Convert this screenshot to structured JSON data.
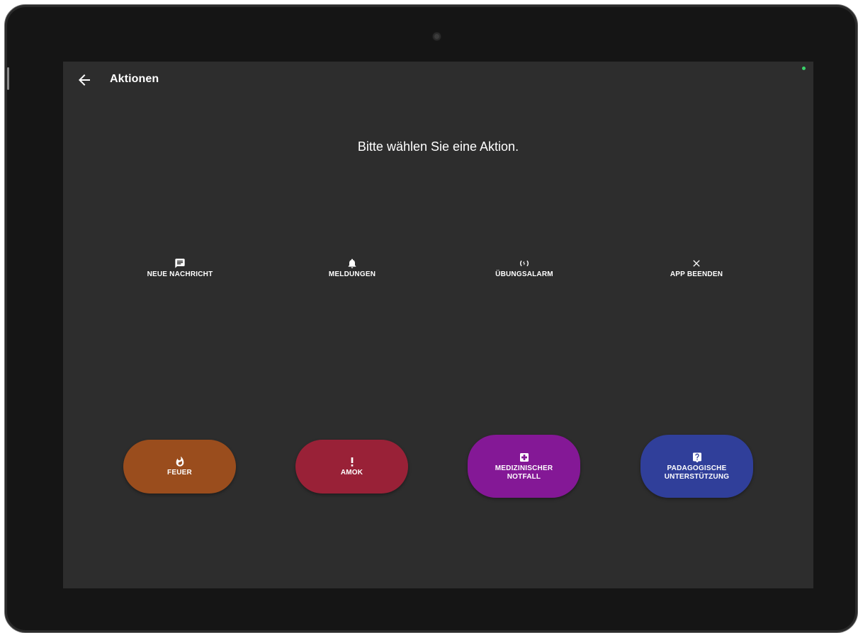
{
  "appbar": {
    "title": "Aktionen",
    "back_icon": "arrow-back-icon"
  },
  "main": {
    "prompt": "Bitte wählen Sie eine Aktion."
  },
  "actions": [
    {
      "label": "NEUE NACHRICHT",
      "icon": "message-icon"
    },
    {
      "label": "MELDUNGEN",
      "icon": "bell-icon"
    },
    {
      "label": "ÜBUNGSALARM",
      "icon": "alarm-practice-icon"
    },
    {
      "label": "APP BEENDEN",
      "icon": "close-icon"
    }
  ],
  "alarms": [
    {
      "label": "FEUER",
      "icon": "fire-icon",
      "color": "#9a4d1d"
    },
    {
      "label": "AMOK",
      "icon": "exclamation-icon",
      "color": "#992137"
    },
    {
      "label": "MEDIZINISCHER\nNOTFALL",
      "icon": "medical-cross-icon",
      "color": "#841896"
    },
    {
      "label": "PADAGOGISCHE\nUNTERSTÜTZUNG",
      "icon": "help-icon",
      "color": "#303f9a"
    }
  ],
  "colors": {
    "screen_background": "#2d2d2d",
    "status_indicator": "#39d36a"
  }
}
